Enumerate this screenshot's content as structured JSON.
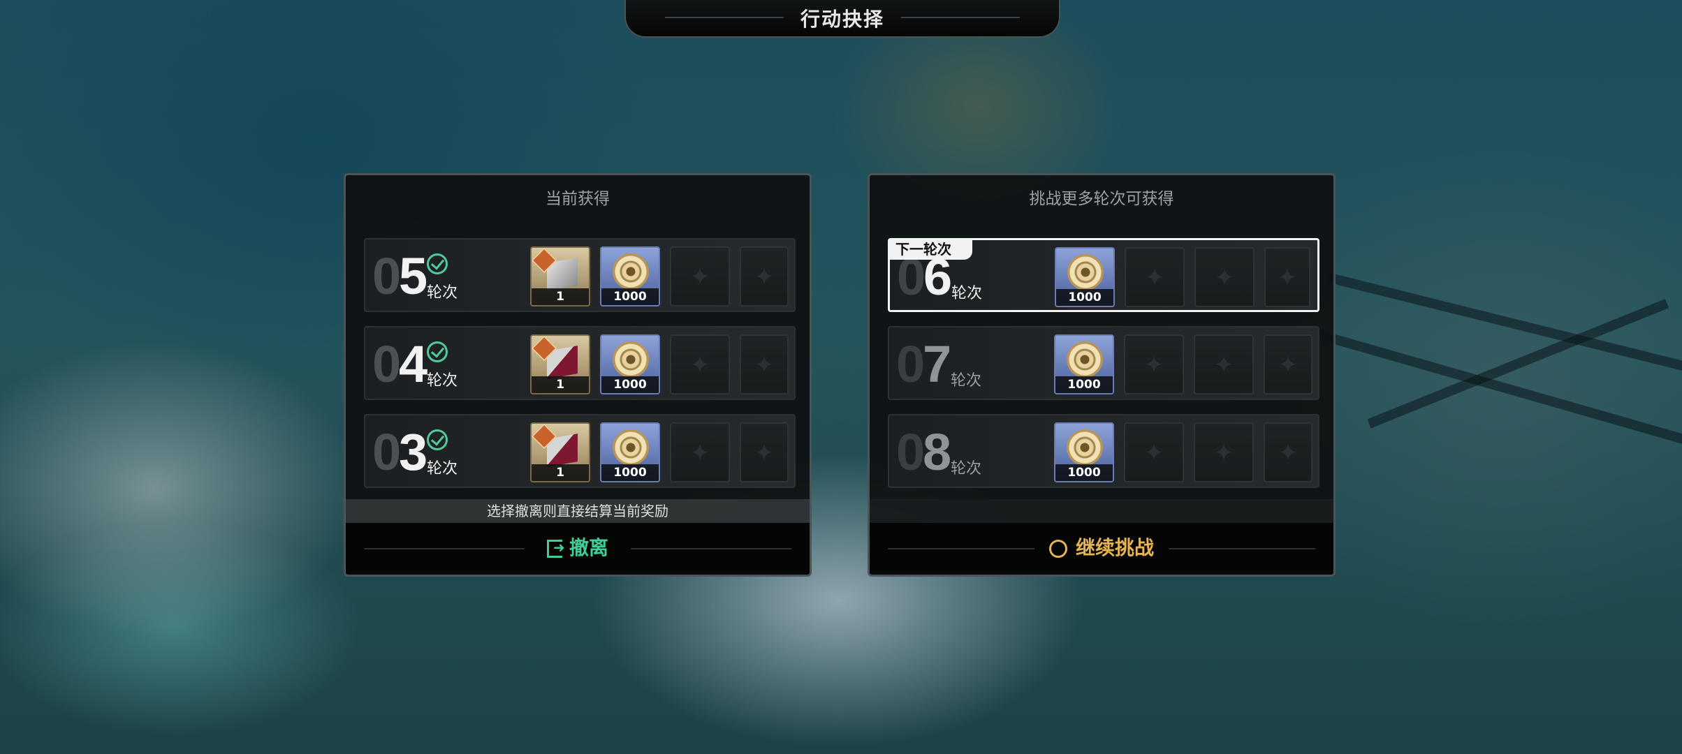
{
  "header": {
    "title": "行动抉择"
  },
  "left_panel": {
    "heading": "当前获得",
    "rows": [
      {
        "prefix": "0",
        "number": "5",
        "label": "轮次",
        "item_qty": "1",
        "coin_qty": "1000"
      },
      {
        "prefix": "0",
        "number": "4",
        "label": "轮次",
        "item_qty": "1",
        "coin_qty": "1000"
      },
      {
        "prefix": "0",
        "number": "3",
        "label": "轮次",
        "item_qty": "1",
        "coin_qty": "1000"
      }
    ],
    "hint": "选择撤离则直接结算当前奖励",
    "action": "撤离"
  },
  "right_panel": {
    "heading": "挑战更多轮次可获得",
    "next_tag": "下一轮次",
    "rows": [
      {
        "prefix": "0",
        "number": "6",
        "label": "轮次",
        "coin_qty": "1000"
      },
      {
        "prefix": "0",
        "number": "7",
        "label": "轮次",
        "coin_qty": "1000"
      },
      {
        "prefix": "0",
        "number": "8",
        "label": "轮次",
        "coin_qty": "1000"
      }
    ],
    "action": "继续挑战"
  },
  "colors": {
    "exit_accent": "#3fcf95",
    "continue_accent": "#e7b54e",
    "check_green": "#4fcb9c"
  },
  "icons": {
    "check": "check-circle-icon",
    "exit": "exit-door-icon",
    "continue": "ring-icon",
    "empty_slot": "diamond-star-icon"
  }
}
